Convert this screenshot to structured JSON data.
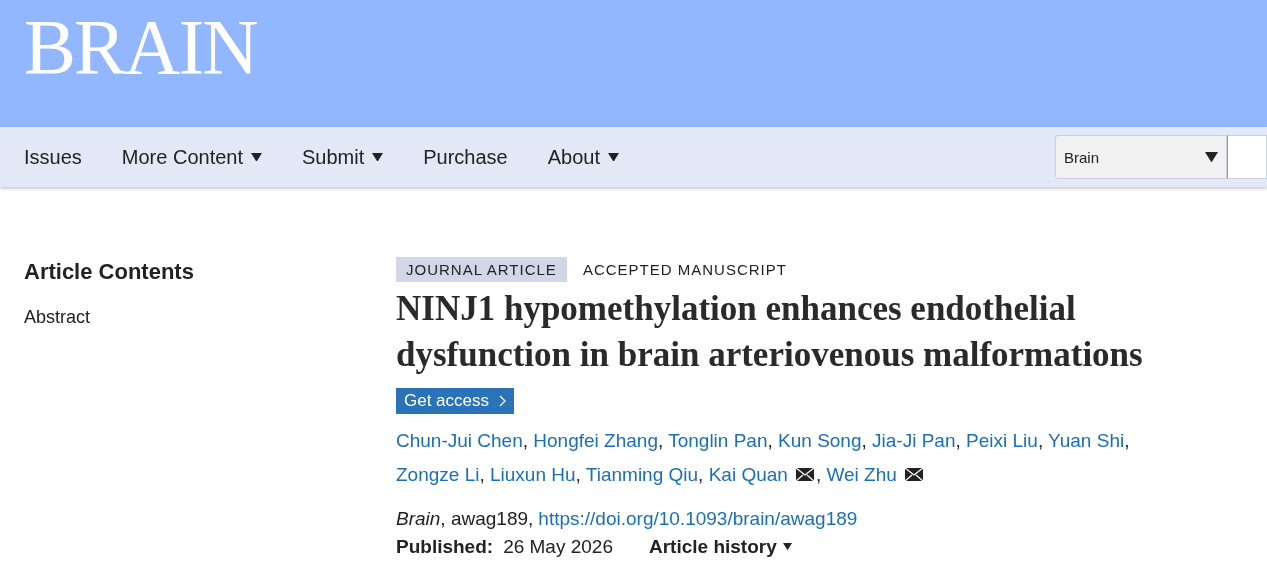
{
  "header": {
    "logo": "BRAIN"
  },
  "nav": {
    "items": [
      {
        "label": "Issues",
        "dropdown": false
      },
      {
        "label": "More Content",
        "dropdown": true
      },
      {
        "label": "Submit",
        "dropdown": true
      },
      {
        "label": "Purchase",
        "dropdown": false
      },
      {
        "label": "About",
        "dropdown": true
      }
    ],
    "search_scope": "Brain"
  },
  "sidebar": {
    "title": "Article Contents",
    "items": [
      "Abstract"
    ]
  },
  "article": {
    "tags": [
      {
        "label": "JOURNAL ARTICLE",
        "highlighted": true
      },
      {
        "label": "ACCEPTED MANUSCRIPT",
        "highlighted": false
      }
    ],
    "title": "NINJ1 hypomethylation enhances endothelial dysfunction in brain arteriovenous malformations",
    "access_button": "Get access",
    "authors": [
      {
        "name": "Chun-Jui Chen",
        "corresponding": false,
        "after": ","
      },
      {
        "name": "Hongfei Zhang",
        "corresponding": false,
        "after": ","
      },
      {
        "name": "Tonglin Pan",
        "corresponding": false,
        "after": ","
      },
      {
        "name": "Kun Song",
        "corresponding": false,
        "after": ","
      },
      {
        "name": "Jia-Ji Pan",
        "corresponding": false,
        "after": ","
      },
      {
        "name": "Peixi Liu",
        "corresponding": false,
        "after": ","
      },
      {
        "name": "Yuan Shi",
        "corresponding": false,
        "after": ","
      },
      {
        "name": "Zongze Li",
        "corresponding": false,
        "after": ","
      },
      {
        "name": "Liuxun Hu",
        "corresponding": false,
        "after": ","
      },
      {
        "name": "Tianming Qiu",
        "corresponding": false,
        "after": ","
      },
      {
        "name": "Kai Quan",
        "corresponding": true,
        "after": ","
      },
      {
        "name": "Wei Zhu",
        "corresponding": true
      }
    ],
    "citation": {
      "journal": "Brain",
      "id": ", awag189,",
      "doi": "https://doi.org/10.1093/brain/awag189"
    },
    "published_label": "Published:",
    "published_date": "26 May 2026",
    "history": "Article history"
  }
}
